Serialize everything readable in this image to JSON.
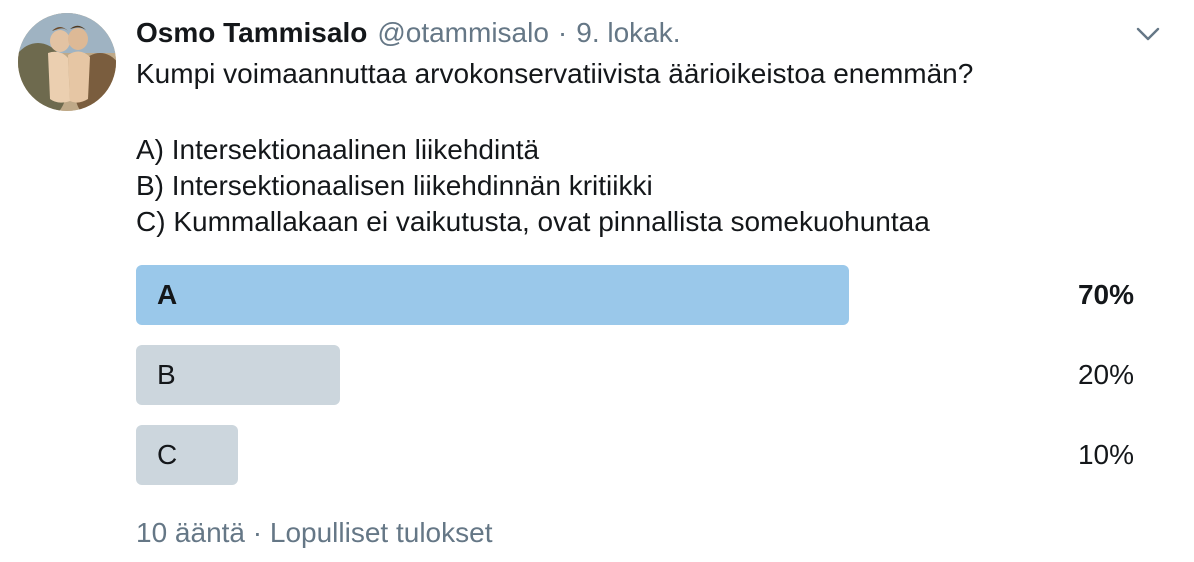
{
  "author": {
    "name": "Osmo Tammisalo",
    "handle": "@otammisalo",
    "separator": "·",
    "date": "9. lokak."
  },
  "tweet": {
    "lines": [
      "Kumpi voimaannuttaa arvokonservatiivista äärioikeistoa enemmän?",
      "A) Intersektionaalinen liikehdintä",
      "B) Intersektionaalisen liikehdinnän kritiikki",
      "C) Kummallakaan ei vaikutusta, ovat pinnallista somekuohuntaa"
    ]
  },
  "poll": {
    "options": [
      {
        "label": "A",
        "percent_text": "70%",
        "fraction": 0.7,
        "winner": true
      },
      {
        "label": "B",
        "percent_text": "20%",
        "fraction": 0.2,
        "winner": false
      },
      {
        "label": "C",
        "percent_text": "10%",
        "fraction": 0.1,
        "winner": false
      }
    ],
    "votes": "10 ääntä",
    "separator": "·",
    "status": "Lopulliset tulokset"
  },
  "colors": {
    "winner_bar": "#9ac8ea",
    "other_bar": "#ccd6dd",
    "secondary_text": "#657786"
  },
  "icons": {
    "avatar": "profile-photo",
    "menu": "chevron-down-icon"
  }
}
